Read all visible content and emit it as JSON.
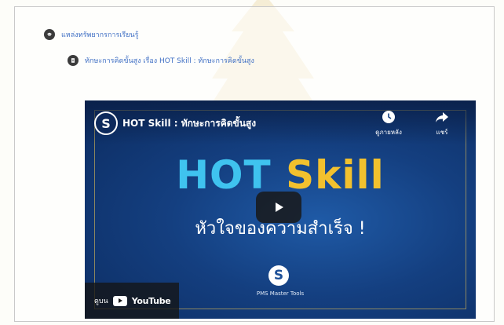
{
  "breadcrumb": {
    "level1": {
      "icon": "cap-icon",
      "label": "แหล่งทรัพยากรการเรียนรู้"
    },
    "level2": {
      "icon": "page-icon",
      "label": "ทักษะการคิดขั้นสูง เรื่อง HOT Skill : ทักษะการคิดขั้นสูง"
    }
  },
  "player": {
    "title": "HOT Skill : ทักษะการคิดขั้นสูง",
    "channel_logo": "S",
    "watch_later_label": "ดูภายหลัง",
    "share_label": "แชร์",
    "headline_hot": "HOT",
    "headline_skill": "Skill",
    "subline": "หัวใจของความสำเร็จ !",
    "brand_logo": "S",
    "brand_name": "PMS Master Tools",
    "watch_on_label": "ดูบน",
    "youtube_label": "YouTube",
    "colors": {
      "hot": "#3fc3ef",
      "skill": "#f2c12e",
      "background": "#143f80"
    }
  }
}
